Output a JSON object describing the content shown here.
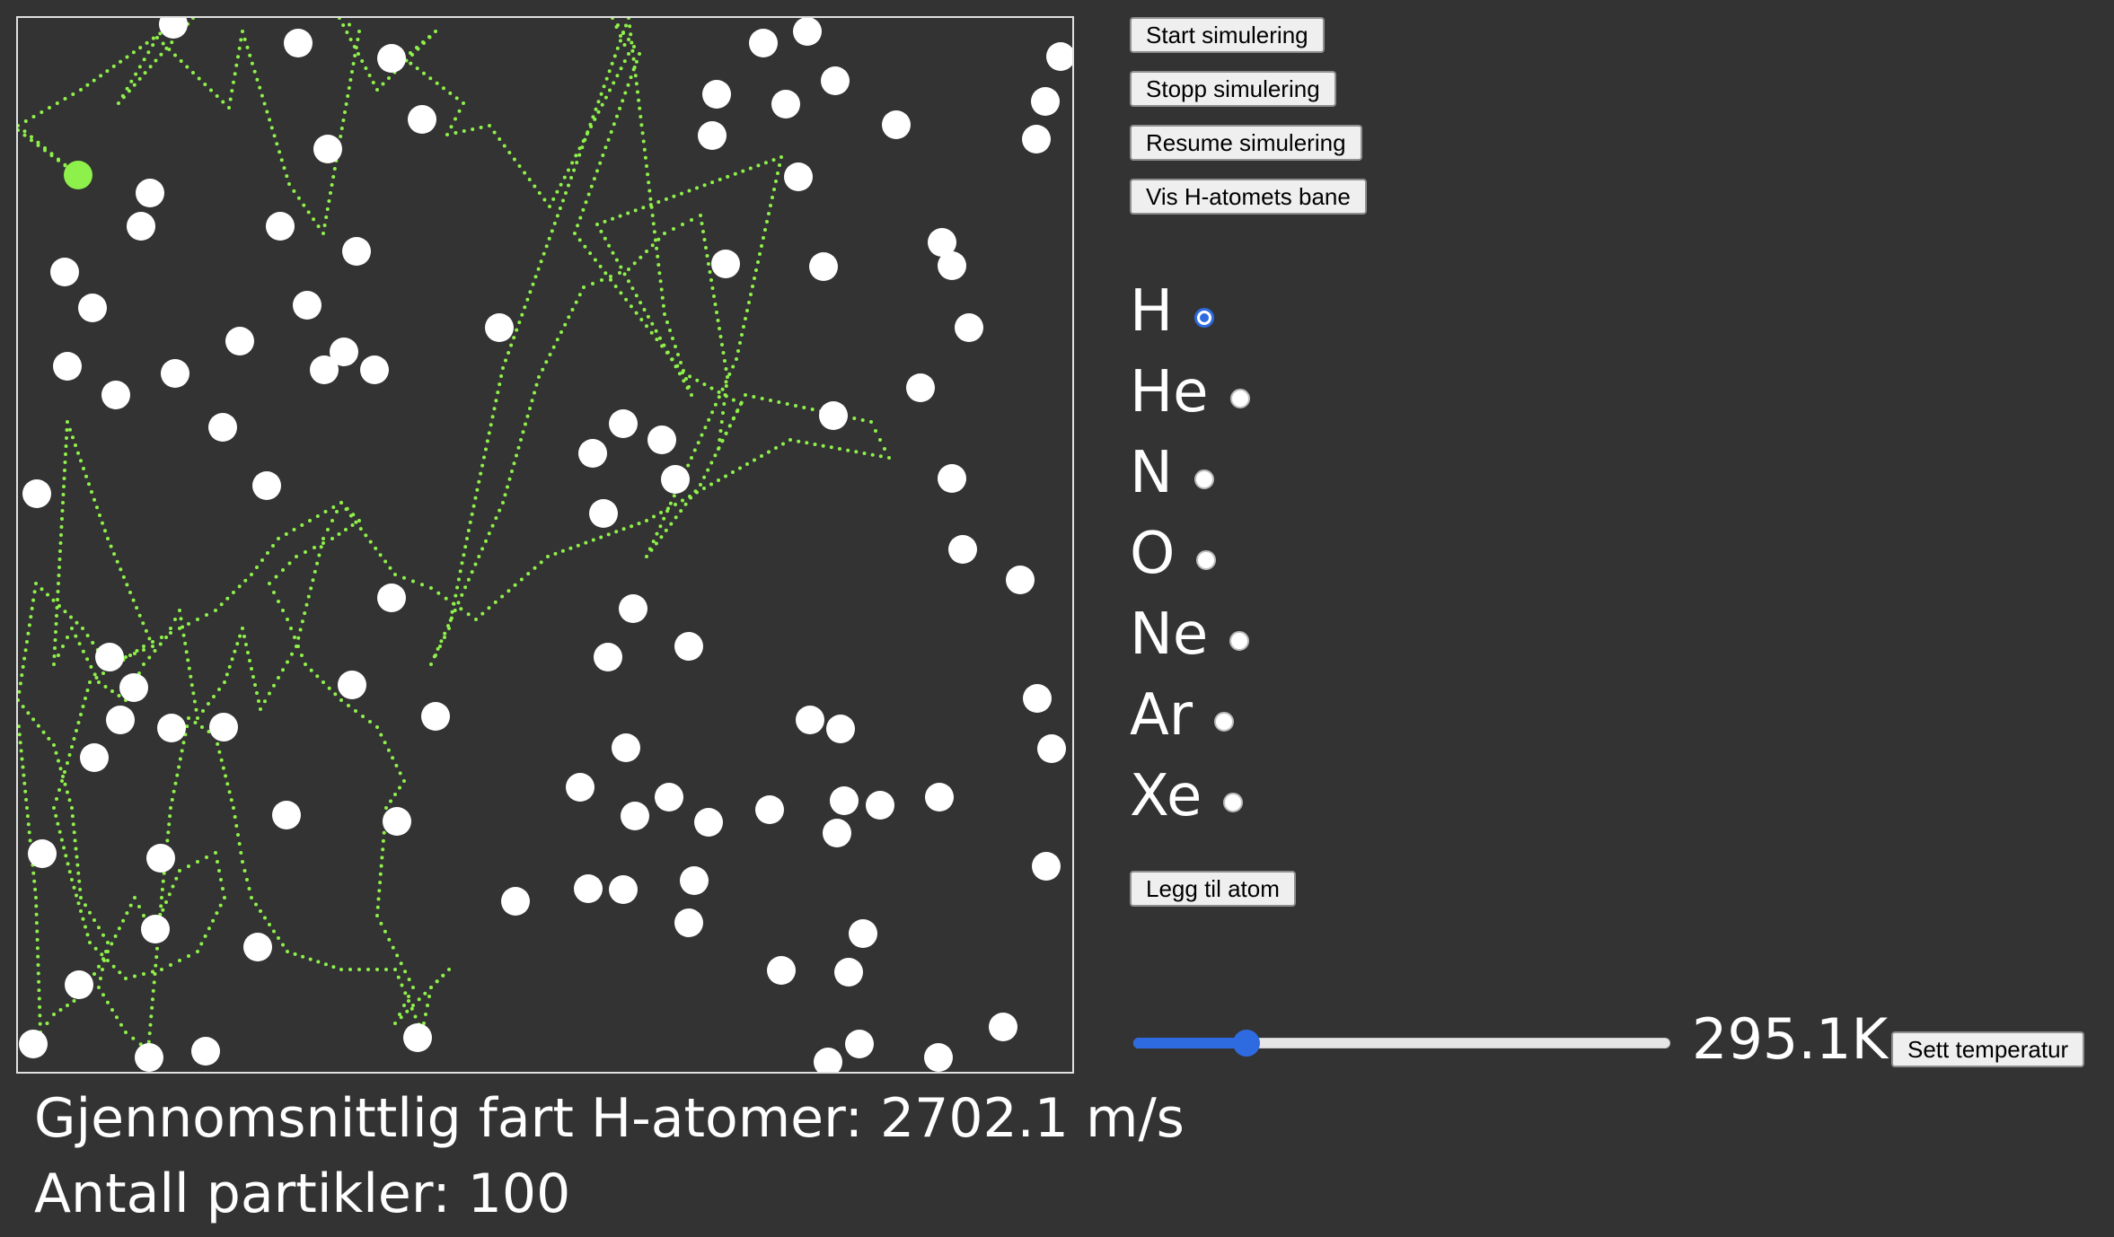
{
  "controls": {
    "start_label": "Start simulering",
    "stop_label": "Stopp simulering",
    "resume_label": "Resume simulering",
    "show_path_label": "Vis H-atomets bane",
    "add_atom_label": "Legg til atom",
    "set_temp_label": "Sett temperatur"
  },
  "elements": [
    {
      "symbol": "H",
      "selected": true
    },
    {
      "symbol": "He",
      "selected": false
    },
    {
      "symbol": "N",
      "selected": false
    },
    {
      "symbol": "O",
      "selected": false
    },
    {
      "symbol": "Ne",
      "selected": false
    },
    {
      "symbol": "Ar",
      "selected": false
    },
    {
      "symbol": "Xe",
      "selected": false
    }
  ],
  "temperature": {
    "display": "295.1K",
    "slider_fraction": 0.21
  },
  "stats": {
    "avg_speed": "Gjennomsnittlig fart H-atomer: 2702.1 m/s",
    "particle_count": "Antall partikler: 100"
  },
  "colors": {
    "background": "#333333",
    "particle": "#ffffff",
    "tracked_atom": "#8ef04a",
    "trail": "#8ef04a",
    "accent": "#2f6be0"
  }
}
